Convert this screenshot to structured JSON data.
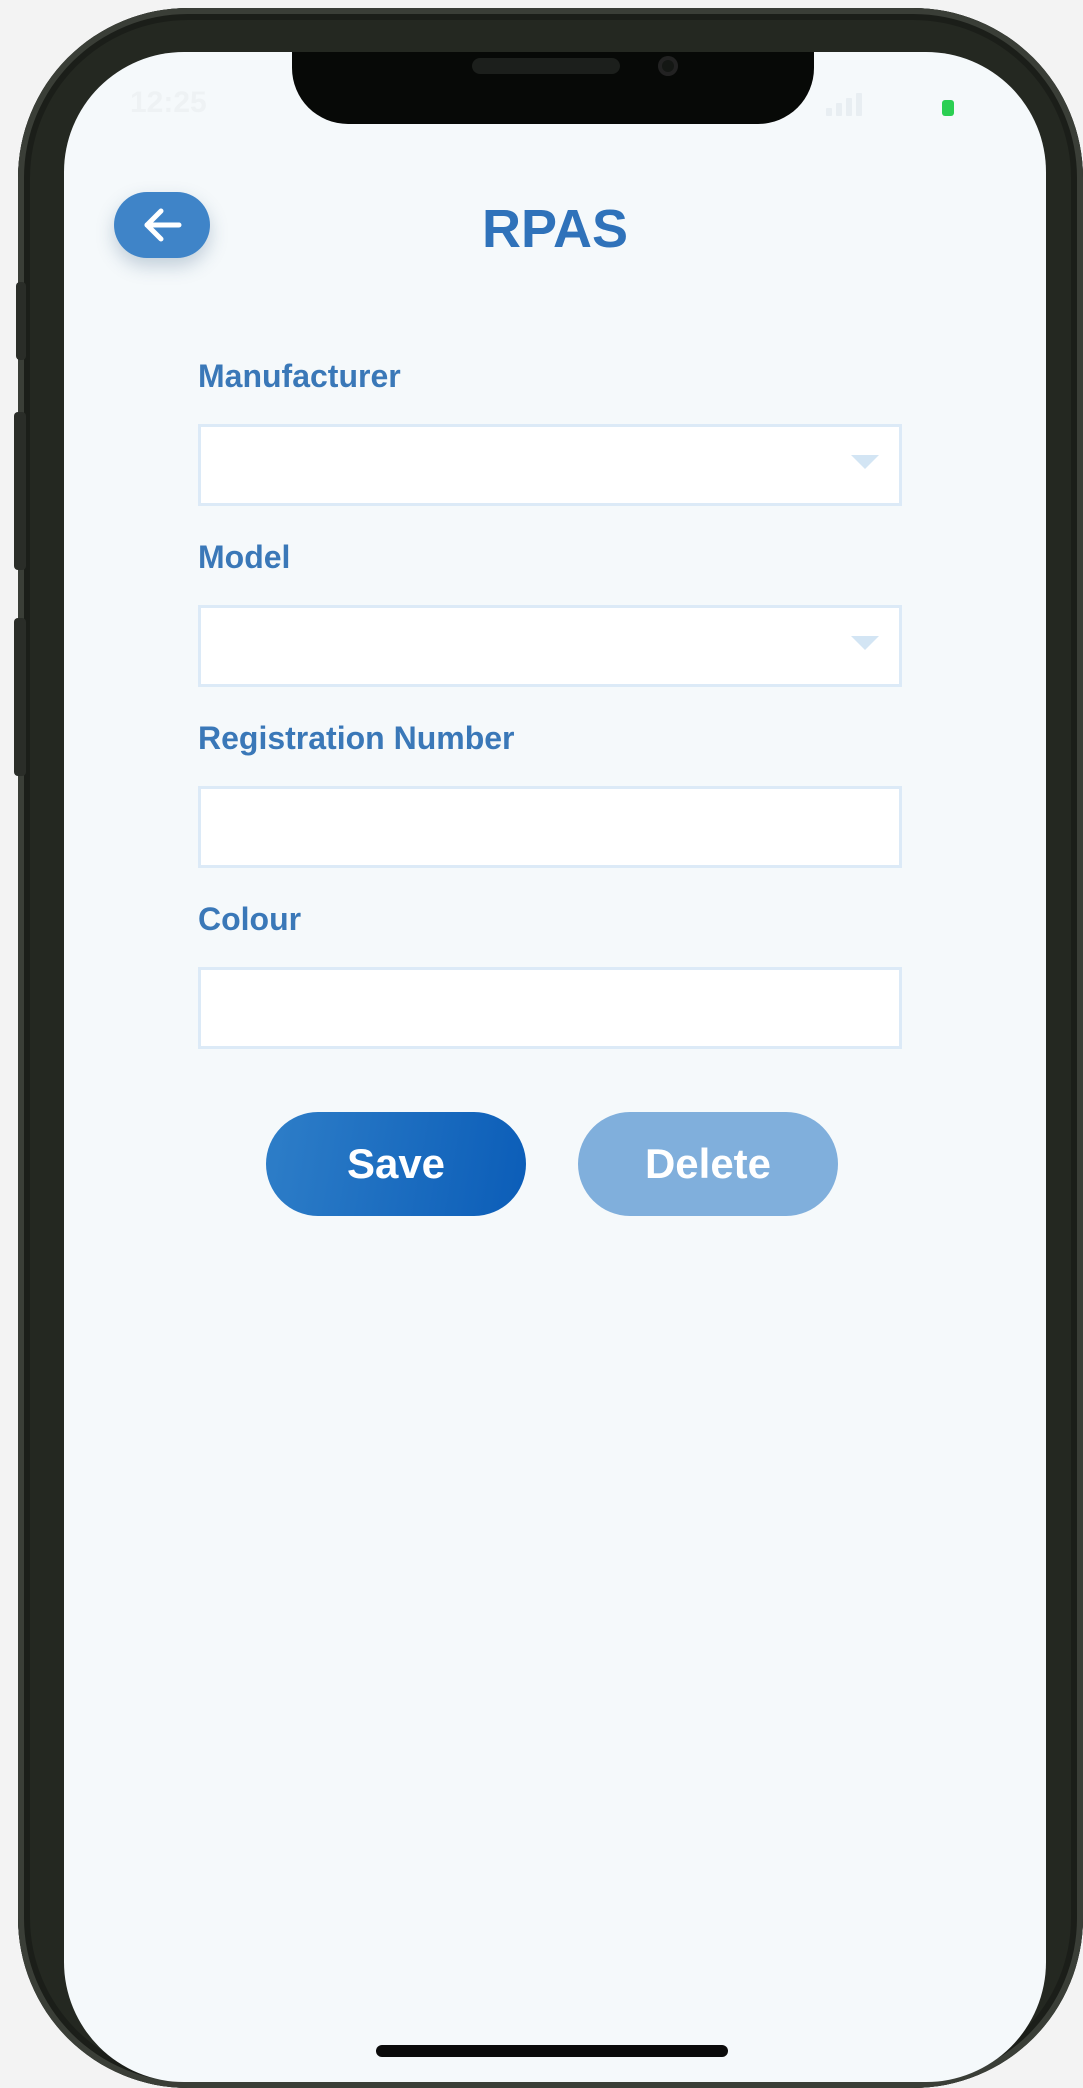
{
  "status_bar": {
    "time": "12:25"
  },
  "header": {
    "title": "RPAS"
  },
  "form": {
    "fields": [
      {
        "label": "Manufacturer",
        "value": "",
        "type": "dropdown"
      },
      {
        "label": "Model",
        "value": "",
        "type": "dropdown"
      },
      {
        "label": "Registration Number",
        "value": "",
        "type": "text"
      },
      {
        "label": "Colour",
        "value": "",
        "type": "text"
      }
    ]
  },
  "actions": {
    "save_label": "Save",
    "delete_label": "Delete"
  },
  "colors": {
    "primary": "#2f72ba",
    "save_button": "#0b5db8",
    "delete_button": "#80afdc",
    "screen_background": "#f5f9fb",
    "field_border": "#dceaf7"
  }
}
